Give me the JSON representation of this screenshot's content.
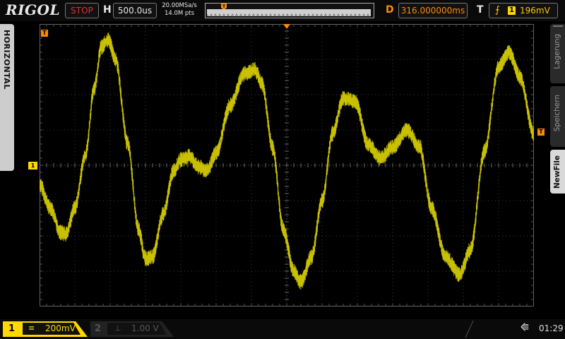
{
  "brand": "RIGOL",
  "top": {
    "run_state": "STOP",
    "h_label": "H",
    "timebase": "500.0us",
    "sample_rate": "20.00MSa/s",
    "memory_depth": "14.0M pts",
    "delay_label": "D",
    "delay": "316.000000ms",
    "trigger_label": "T",
    "trigger_source": "1",
    "trigger_level": "196mV",
    "trigger_marker": "T"
  },
  "left_tab": "HORIZONTAL",
  "markers": {
    "trigger_pos": "T",
    "trigger_level": "T",
    "ch1": "1"
  },
  "menu": [
    {
      "label": "Lagerung",
      "active": false
    },
    {
      "label": "Speichern",
      "active": false
    },
    {
      "label": "NewFile",
      "active": true
    }
  ],
  "bottom": {
    "ch1_num": "1",
    "ch1_coupling": "≡",
    "ch1_scale": "200mV",
    "ch2_num": "2",
    "ch2_coupling": "⊥",
    "ch2_scale": "1.00 V",
    "usb_icon": "usb-icon",
    "time": "01:29"
  },
  "colors": {
    "trace": "#c8c000",
    "accent_orange": "#ff8a00",
    "ch1_yellow": "#ffd800",
    "stop_red": "#e0303b"
  },
  "grid": {
    "h_divisions": 14,
    "v_divisions": 8
  },
  "waveform": {
    "description_points_div": [
      [
        0.0,
        -0.55
      ],
      [
        0.3,
        -1.2
      ],
      [
        0.6,
        -1.9
      ],
      [
        0.75,
        -1.95
      ],
      [
        1.0,
        -1.2
      ],
      [
        1.3,
        0.3
      ],
      [
        1.55,
        2.2
      ],
      [
        1.75,
        3.35
      ],
      [
        1.95,
        3.55
      ],
      [
        2.15,
        3.0
      ],
      [
        2.5,
        0.6
      ],
      [
        2.8,
        -1.8
      ],
      [
        3.0,
        -2.65
      ],
      [
        3.2,
        -2.6
      ],
      [
        3.5,
        -1.4
      ],
      [
        3.8,
        -0.15
      ],
      [
        4.0,
        0.15
      ],
      [
        4.25,
        0.25
      ],
      [
        4.5,
        -0.05
      ],
      [
        4.75,
        -0.15
      ],
      [
        5.0,
        0.35
      ],
      [
        5.4,
        1.7
      ],
      [
        5.8,
        2.6
      ],
      [
        6.1,
        2.7
      ],
      [
        6.3,
        2.3
      ],
      [
        6.6,
        0.5
      ],
      [
        6.9,
        -1.8
      ],
      [
        7.2,
        -3.0
      ],
      [
        7.4,
        -3.3
      ],
      [
        7.7,
        -2.6
      ],
      [
        8.0,
        -1.0
      ],
      [
        8.3,
        0.9
      ],
      [
        8.6,
        1.9
      ],
      [
        8.95,
        1.8
      ],
      [
        9.3,
        0.6
      ],
      [
        9.65,
        0.2
      ],
      [
        10.0,
        0.5
      ],
      [
        10.4,
        1.0
      ],
      [
        10.75,
        0.55
      ],
      [
        11.1,
        -1.2
      ],
      [
        11.5,
        -2.6
      ],
      [
        11.9,
        -3.1
      ],
      [
        12.2,
        -2.4
      ],
      [
        12.6,
        0.4
      ],
      [
        13.0,
        2.8
      ],
      [
        13.3,
        3.2
      ],
      [
        13.6,
        2.5
      ],
      [
        14.0,
        0.9
      ]
    ],
    "noise_div": 0.16
  }
}
